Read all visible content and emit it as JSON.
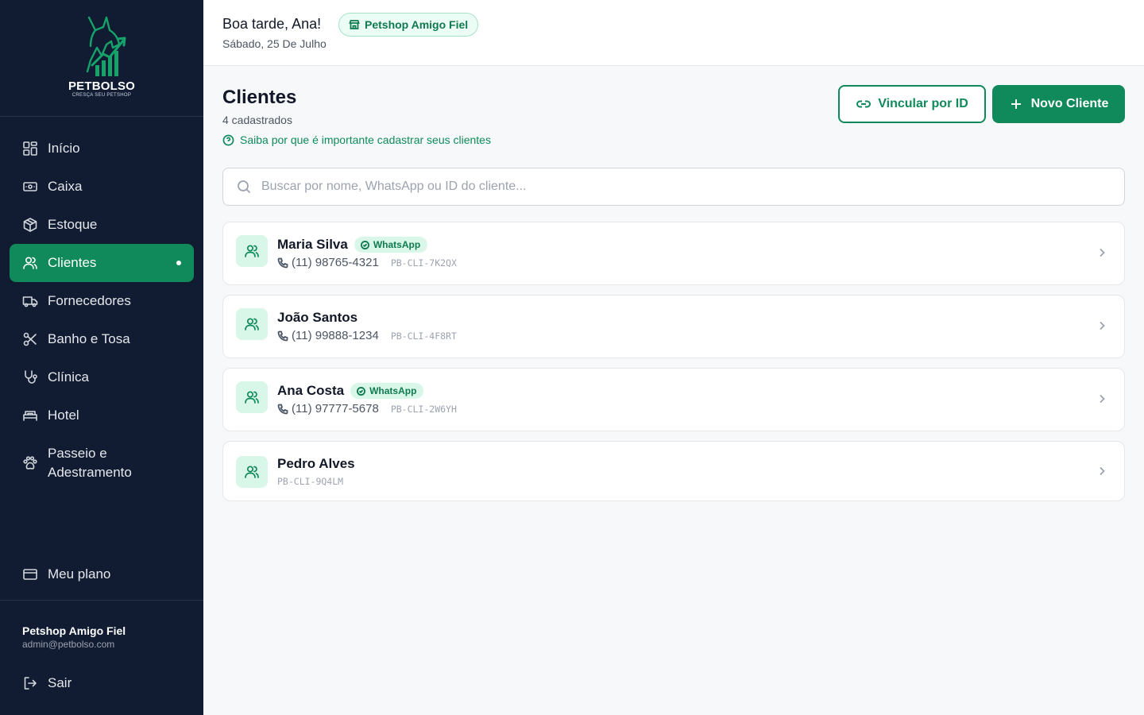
{
  "brand": {
    "name": "PETBOLSO",
    "tagline": "CRESÇA SEU PETSHOP",
    "accent": "#108a5a",
    "sidebar_bg": "#111c33"
  },
  "sidebar": {
    "items": [
      {
        "label": "Início",
        "icon": "dashboard-icon"
      },
      {
        "label": "Caixa",
        "icon": "cash-icon"
      },
      {
        "label": "Estoque",
        "icon": "package-icon"
      },
      {
        "label": "Clientes",
        "icon": "users-icon",
        "active": true
      },
      {
        "label": "Fornecedores",
        "icon": "truck-icon"
      },
      {
        "label": "Banho e Tosa",
        "icon": "scissors-icon"
      },
      {
        "label": "Clínica",
        "icon": "stethoscope-icon"
      },
      {
        "label": "Hotel",
        "icon": "bed-icon"
      },
      {
        "label": "Passeio e Adestramento",
        "icon": "paw-icon"
      }
    ],
    "plan_label": "Meu plano",
    "account": {
      "name": "Petshop Amigo Fiel",
      "email": "admin@petbolso.com"
    },
    "logout_label": "Sair"
  },
  "header": {
    "greeting": "Boa tarde, Ana!",
    "store": "Petshop Amigo Fiel",
    "date": "Sábado, 25 De Julho"
  },
  "page": {
    "title": "Clientes",
    "count": "4 cadastrados",
    "info_link": "Saiba por que é importante cadastrar seus clientes",
    "link_button": "Vincular por ID",
    "new_button": "Novo Cliente",
    "search_placeholder": "Buscar por nome, WhatsApp ou ID do cliente..."
  },
  "clients": [
    {
      "name": "Maria Silva",
      "whatsapp": "WhatsApp",
      "phone": "(11) 98765-4321",
      "id": "PB-CLI-7K2QX"
    },
    {
      "name": "João Santos",
      "phone": "(11) 99888-1234",
      "id": "PB-CLI-4F8RT"
    },
    {
      "name": "Ana Costa",
      "whatsapp": "WhatsApp",
      "phone": "(11) 97777-5678",
      "id": "PB-CLI-2W6YH"
    },
    {
      "name": "Pedro Alves",
      "id": "PB-CLI-9Q4LM"
    }
  ]
}
